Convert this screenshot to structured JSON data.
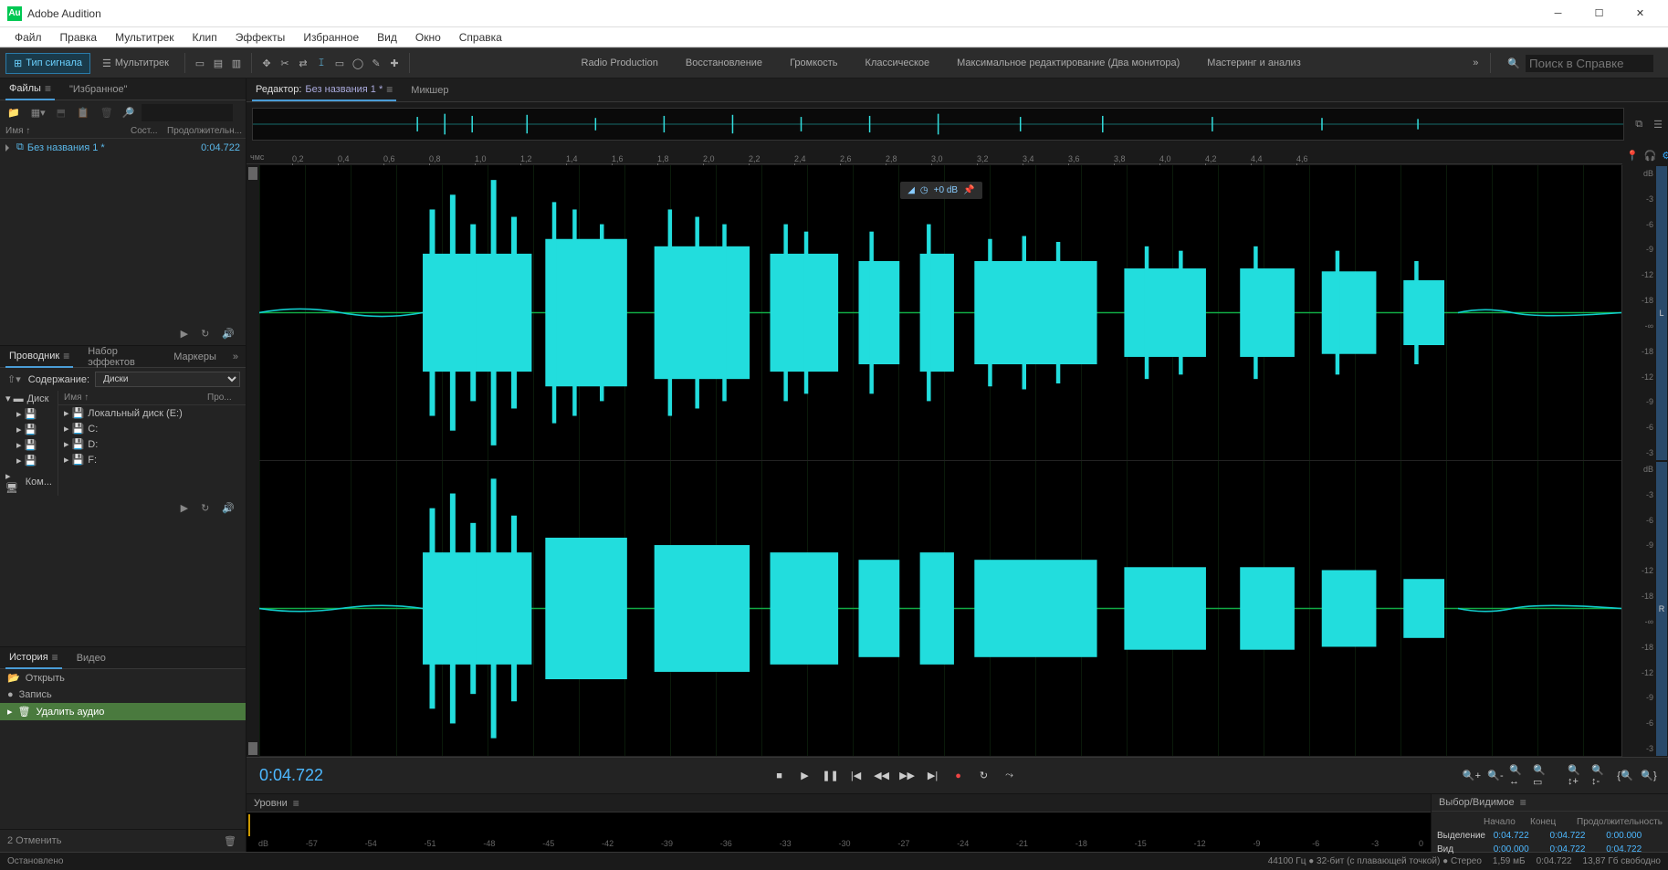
{
  "app": {
    "title": "Adobe Audition",
    "logo": "Au"
  },
  "menu": [
    "Файл",
    "Правка",
    "Мультитрек",
    "Клип",
    "Эффекты",
    "Избранное",
    "Вид",
    "Окно",
    "Справка"
  ],
  "toolbar": {
    "waveform": "Тип сигнала",
    "multitrack": "Мультитрек"
  },
  "workspaces": [
    "Radio Production",
    "Восстановление",
    "Громкость",
    "Классическое",
    "Максимальное редактирование (Два монитора)",
    "Мастеринг и анализ"
  ],
  "search": {
    "placeholder": "Поиск в Справке"
  },
  "files_panel": {
    "tab_files": "Файлы",
    "tab_fav": "\"Избранное\"",
    "col_name": "Имя",
    "col_status": "Сост...",
    "col_dur": "Продолжительн...",
    "file1_name": "Без названия 1 *",
    "file1_dur": "0:04.722",
    "search_placeholder": ""
  },
  "explorer_panel": {
    "tab_explorer": "Проводник",
    "tab_effects": "Набор эффектов",
    "tab_markers": "Маркеры",
    "content_label": "Содержание:",
    "content_value": "Диски",
    "col_name": "Имя",
    "col_dur": "Про...",
    "tree_disks": "Диск",
    "tree_komp": "Ком...",
    "d1": "Локальный диск (E:)",
    "d2": "C:",
    "d3": "D:",
    "d4": "F:"
  },
  "history_panel": {
    "tab_history": "История",
    "tab_video": "Видео",
    "row_open": "Открыть",
    "row_rec": "Запись",
    "row_del": "Удалить аудио",
    "undo_label": "2 Отменить"
  },
  "editor": {
    "tab_editor_label": "Редактор:",
    "tab_editor_file": "Без названия 1 *",
    "tab_mixer": "Микшер",
    "ruler_unit": "чмс",
    "ticks": [
      "0,2",
      "0,4",
      "0,6",
      "0,8",
      "1,0",
      "1,2",
      "1,4",
      "1,6",
      "1,8",
      "2,0",
      "2,2",
      "2,4",
      "2,6",
      "2,8",
      "3,0",
      "3,2",
      "3,4",
      "3,6",
      "3,8",
      "4,0",
      "4,2",
      "4,4",
      "4,6"
    ],
    "hud_db": "+0 dB",
    "db_label": "dB",
    "db_marks": [
      "-3",
      "-6",
      "-9",
      "-12",
      "-18",
      "-∞",
      "-18",
      "-12",
      "-9",
      "-6",
      "-3"
    ],
    "ch_left": "L",
    "ch_right": "R",
    "timecode": "0:04.722"
  },
  "levels": {
    "title": "Уровни",
    "db_label": "dB",
    "marks": [
      "-57",
      "-54",
      "-51",
      "-48",
      "-45",
      "-42",
      "-39",
      "-36",
      "-33",
      "-30",
      "-27",
      "-24",
      "-21",
      "-18",
      "-15",
      "-12",
      "-9",
      "-6",
      "-3",
      "0"
    ]
  },
  "selection_panel": {
    "title": "Выбор/Видимое",
    "h_start": "Начало",
    "h_end": "Конец",
    "h_dur": "Продолжительность",
    "r_sel": "Выделение",
    "r_view": "Вид",
    "sel_start": "0:04.722",
    "sel_end": "0:04.722",
    "sel_dur": "0:00.000",
    "view_start": "0:00.000",
    "view_end": "0:04.722",
    "view_dur": "0:04.722"
  },
  "status": {
    "left": "Остановлено",
    "format": "44100 Гц ● 32-бит (с плавающей точкой) ● Стерео",
    "size": "1,59 мБ",
    "dur": "0:04.722",
    "disk": "13,87 Гб свободно"
  }
}
